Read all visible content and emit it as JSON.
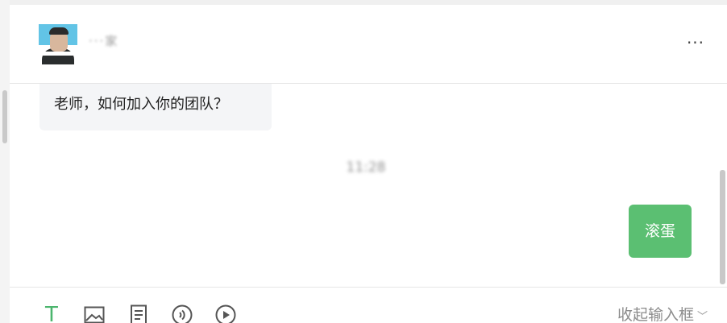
{
  "header": {
    "contact_name": "···家",
    "more_label": "···"
  },
  "messages": {
    "incoming_text": "老师，如何加入你的团队？",
    "timestamp": "11:28",
    "outgoing_text": "滚蛋"
  },
  "toolbar": {
    "text_tool_label": "T",
    "collapse_label": "收起输入框",
    "icons": [
      "text-format-icon",
      "image-icon",
      "document-icon",
      "voice-icon",
      "video-icon",
      "chevron-down-icon"
    ]
  },
  "colors": {
    "accent": "#5bbf72",
    "text_tool": "#4bb56d"
  }
}
